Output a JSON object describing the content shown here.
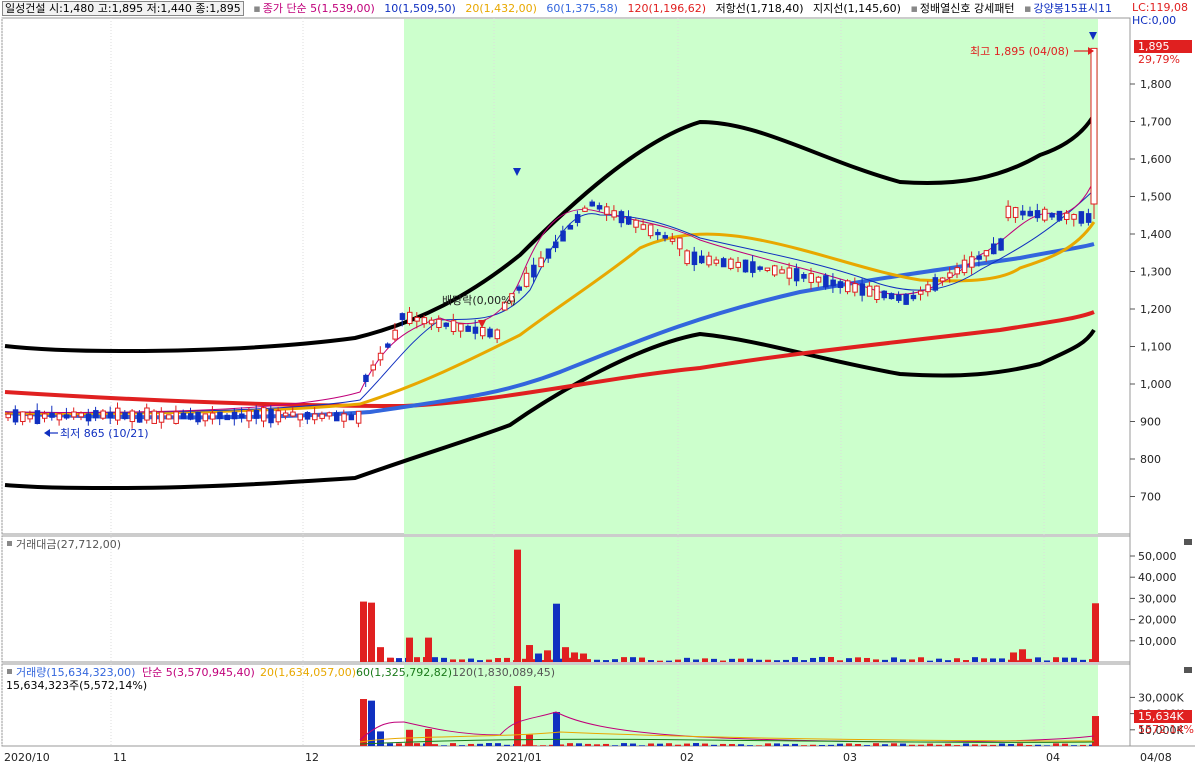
{
  "header": {
    "stock": "일성건설 시:1,480 고:1,895 저:1,440 종:1,895",
    "ma_label": "종가 단순 5(1,539,00)",
    "ma10": "10(1,509,50)",
    "ma20": "20(1,432,00)",
    "ma60": "60(1,375,58)",
    "ma120": "120(1,196,62)",
    "resist": "저항선(1,718,40)",
    "support": "지지선(1,145,60)",
    "pattern": "정배열신호 강세패턴",
    "signal": "강양봉15표시11",
    "lc": "LC:119,08",
    "hc": "HC:0,00"
  },
  "colors": {
    "ma5": "#c0007a",
    "ma10": "#1030c0",
    "ma20": "#e8a800",
    "ma60": "#3366dd",
    "ma120": "#e02020",
    "band": "#000000",
    "highlight": "#ccffcc",
    "up": "#e02020",
    "down": "#1030c0"
  },
  "price_axis": {
    "ticks": [
      "1,800",
      "1,700",
      "1,600",
      "1,500",
      "1,400",
      "1,300",
      "1,200",
      "1,100",
      "1,000",
      "900",
      "800",
      "700"
    ],
    "current": "1,895",
    "current_pct": "29,79%"
  },
  "annotations": {
    "high": "최고 1,895 (04/08)",
    "low": "최저 865 (10/21)",
    "dividend": "배당락(0,00%)"
  },
  "panel2": {
    "title": "거래대금(27,712,00)",
    "ticks": [
      "50,000",
      "40,000",
      "30,000",
      "20,000",
      "10,000"
    ]
  },
  "panel3": {
    "title": "거래량(15,634,323,00)",
    "ma5": "단순 5(3,570,945,40)",
    "ma20": "20(1,634,057,00)",
    "ma60": "60(1,325,792,82)",
    "ma120": "120(1,830,089,45)",
    "sub": "15,634,323주(5,572,14%)",
    "ticks": [
      "30,000K",
      "20,000K",
      "10,000K"
    ],
    "current": "15,634K",
    "current_pct": "5572,14%"
  },
  "x_axis": {
    "labels": [
      "2020/10",
      "11",
      "12",
      "2021/01",
      "02",
      "03",
      "04",
      "04/08"
    ]
  }
}
